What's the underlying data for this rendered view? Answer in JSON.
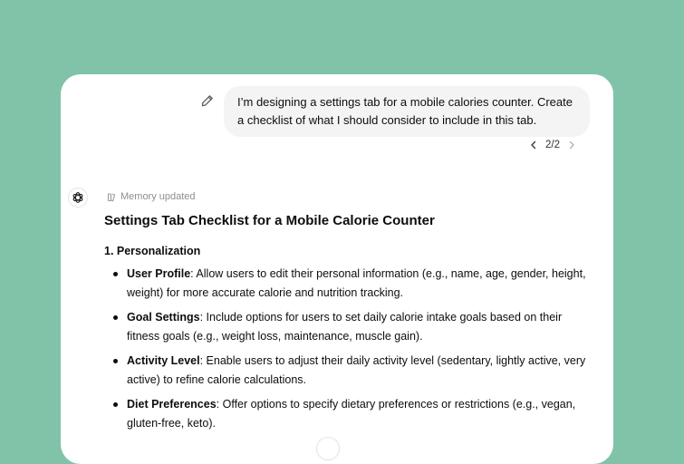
{
  "user_message": {
    "text": "I’m designing a settings tab for a mobile calories counter. Create a checklist of what I should consider to include in this tab.",
    "edit_icon": "pencil-icon"
  },
  "pagination": {
    "current": "2/2",
    "prev_icon": "chevron-left-icon",
    "next_icon": "chevron-right-icon"
  },
  "assistant": {
    "avatar_icon": "openai-logo-icon",
    "memory_status": "Memory updated",
    "title": "Settings Tab Checklist for a Mobile Calorie Counter",
    "section_heading": "1. Personalization",
    "items": [
      {
        "term": "User Profile",
        "desc": ": Allow users to edit their personal information (e.g., name, age, gender, height, weight) for more accurate calorie and nutrition tracking."
      },
      {
        "term": "Goal Settings",
        "desc": ": Include options for users to set daily calorie intake goals based on their fitness goals (e.g., weight loss, maintenance, muscle gain)."
      },
      {
        "term": "Activity Level",
        "desc": ": Enable users to adjust their daily activity level (sedentary, lightly active, very active) to refine calorie calculations."
      },
      {
        "term": "Diet Preferences",
        "desc": ": Offer options to specify dietary preferences or restrictions (e.g., vegan, gluten-free, keto)."
      }
    ]
  },
  "colors": {
    "background": "#80c3a8",
    "card": "#ffffff",
    "bubble": "#f4f4f4",
    "text": "#0d0d0d",
    "muted": "#8e8e8e"
  }
}
